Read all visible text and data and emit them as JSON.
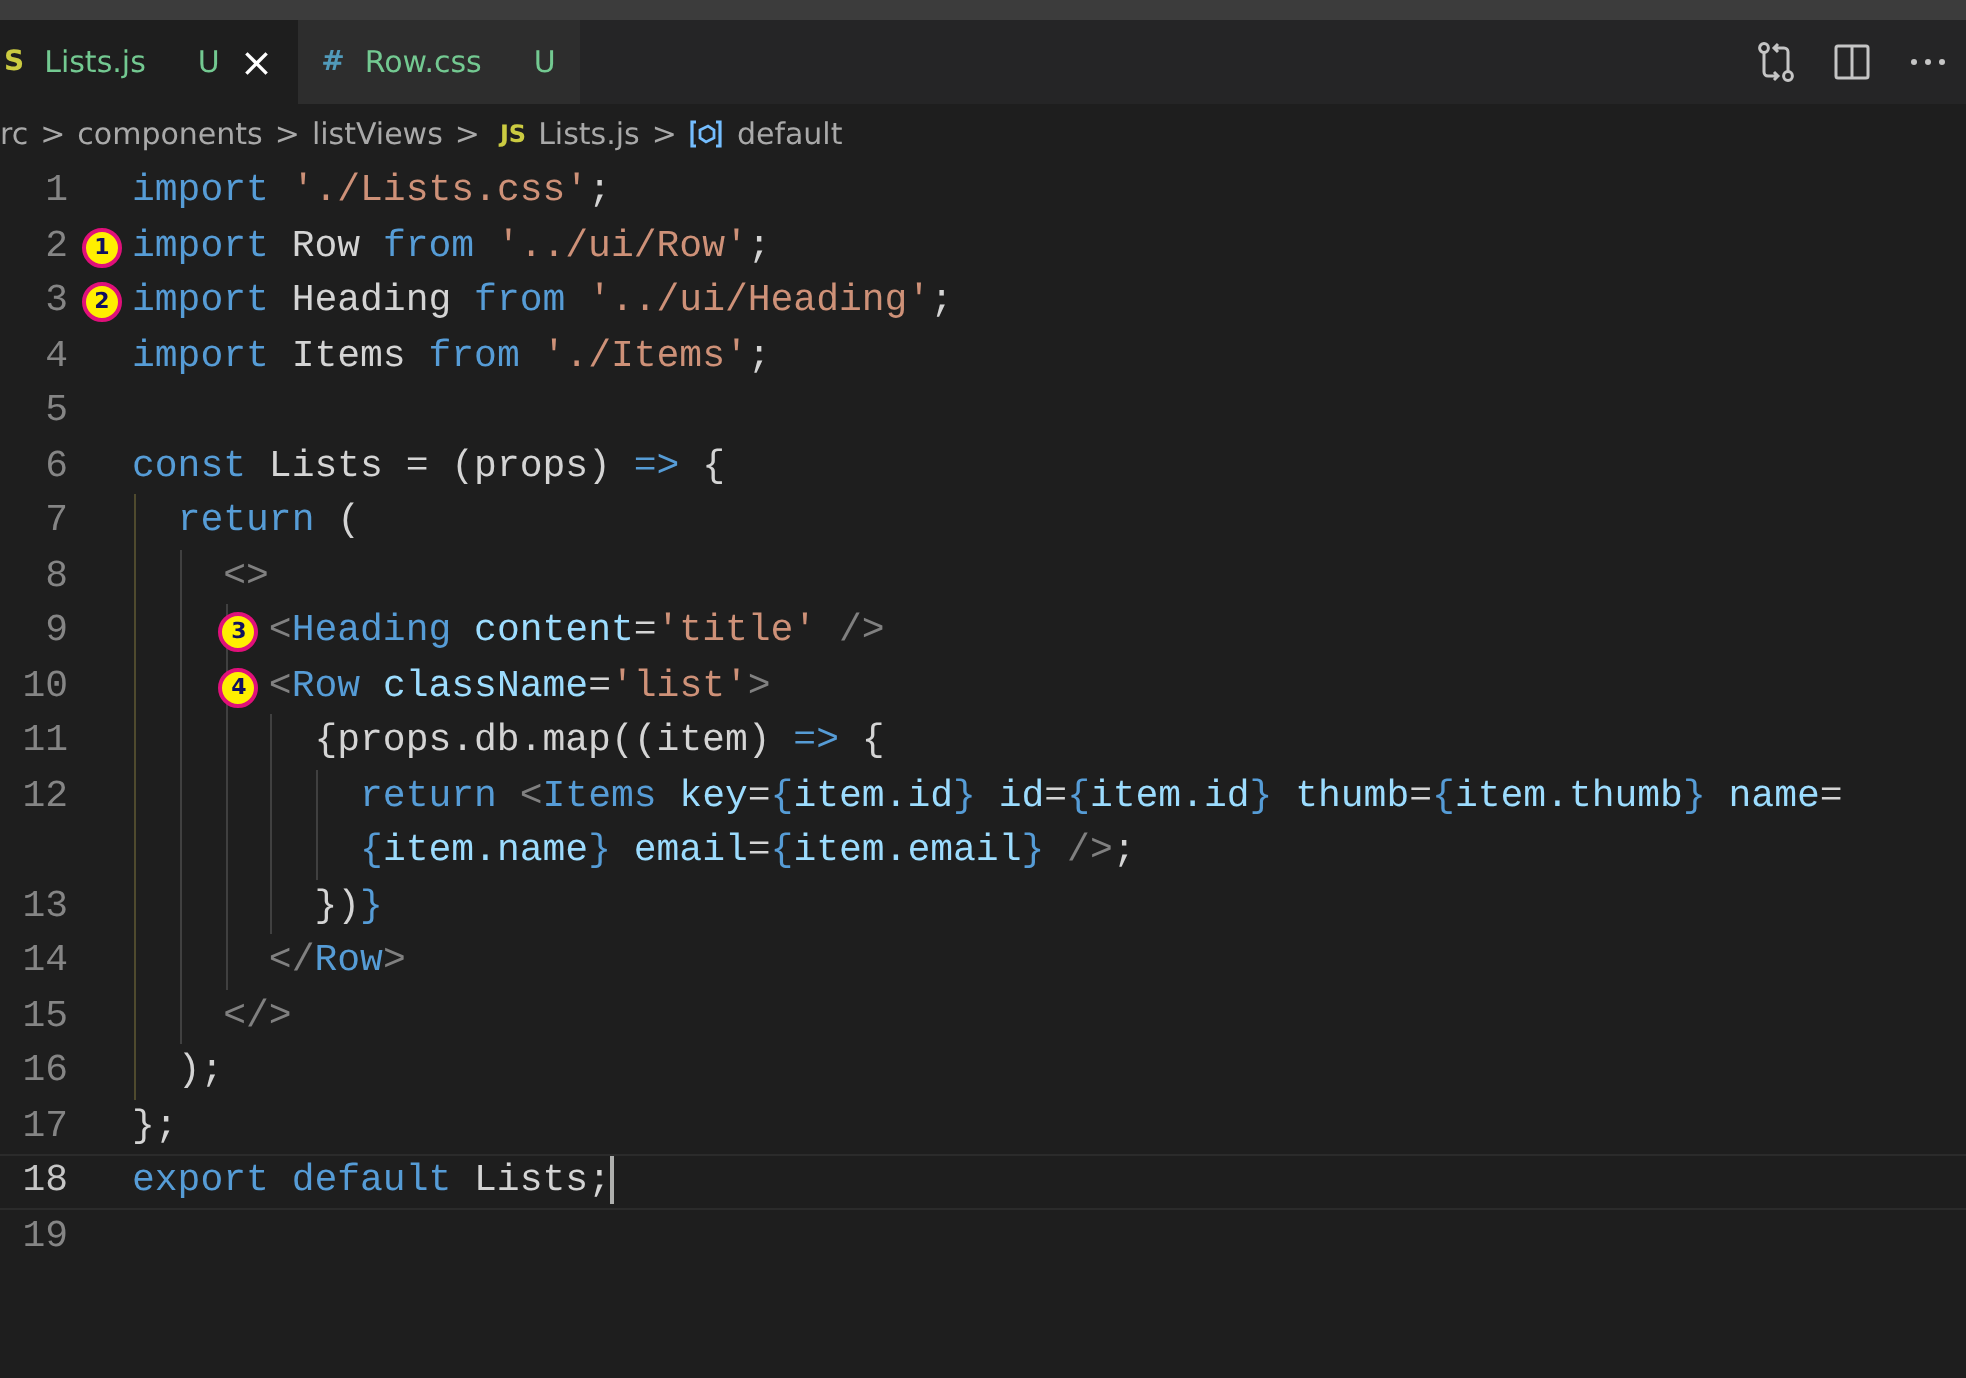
{
  "tabs": [
    {
      "icon": "S",
      "label": "Lists.js",
      "status": "U",
      "close": "×",
      "selected": true,
      "kind": "js"
    },
    {
      "icon": "#",
      "label": "Row.css",
      "status": "U",
      "selected": false,
      "kind": "css"
    }
  ],
  "breadcrumbs": [
    {
      "kind": "folder",
      "label": "rc"
    },
    {
      "kind": "folder",
      "label": "components"
    },
    {
      "kind": "folder",
      "label": "listViews"
    },
    {
      "kind": "file",
      "icon": "JS",
      "label": "Lists.js"
    },
    {
      "kind": "symbol",
      "label": "default"
    }
  ],
  "breadcrumb_separator": ">",
  "lines": [
    {
      "number": "1",
      "current": false,
      "tokens": [
        {
          "kind": "kw",
          "text": "import "
        },
        {
          "kind": "str",
          "text": "'./Lists.css'"
        },
        {
          "kind": "plain",
          "text": ";"
        }
      ]
    },
    {
      "number": "2",
      "current": false,
      "marker": "1",
      "tokens": [
        {
          "kind": "kw",
          "text": "import "
        },
        {
          "kind": "plain",
          "text": "Row "
        },
        {
          "kind": "kw",
          "text": "from "
        },
        {
          "kind": "str",
          "text": "'../ui/Row'"
        },
        {
          "kind": "plain",
          "text": ";"
        }
      ]
    },
    {
      "number": "3",
      "current": false,
      "marker": "2",
      "tokens": [
        {
          "kind": "kw",
          "text": "import "
        },
        {
          "kind": "plain",
          "text": "Heading "
        },
        {
          "kind": "kw",
          "text": "from "
        },
        {
          "kind": "str",
          "text": "'../ui/Heading'"
        },
        {
          "kind": "plain",
          "text": ";"
        }
      ]
    },
    {
      "number": "4",
      "current": false,
      "tokens": [
        {
          "kind": "kw",
          "text": "import "
        },
        {
          "kind": "plain",
          "text": "Items "
        },
        {
          "kind": "kw",
          "text": "from "
        },
        {
          "kind": "str",
          "text": "'./Items'"
        },
        {
          "kind": "plain",
          "text": ";"
        }
      ]
    },
    {
      "number": "5",
      "current": false
    },
    {
      "number": "6",
      "current": false,
      "tokens": [
        {
          "kind": "kw",
          "text": "const "
        },
        {
          "kind": "plain",
          "text": "Lists = (props) "
        },
        {
          "kind": "kw",
          "text": "=>"
        },
        {
          "kind": "plain",
          "text": " {"
        }
      ]
    },
    {
      "number": "7",
      "current": false,
      "tokens": [
        {
          "kind": "kw",
          "text": "  return"
        },
        {
          "kind": "plain",
          "text": " ("
        }
      ]
    },
    {
      "number": "8",
      "current": false,
      "tokens": [
        {
          "kind": "punc",
          "text": "    <>"
        }
      ]
    },
    {
      "number": "9",
      "current": false,
      "marker": "3",
      "tokens": [
        {
          "kind": "punc",
          "text": "      <"
        },
        {
          "kind": "kw",
          "text": "Heading"
        },
        {
          "kind": "var",
          "text": " content"
        },
        {
          "kind": "plain",
          "text": "="
        },
        {
          "kind": "str",
          "text": "'title'"
        },
        {
          "kind": "punc",
          "text": " />"
        }
      ]
    },
    {
      "number": "10",
      "current": false,
      "marker": "4",
      "tokens": [
        {
          "kind": "punc",
          "text": "      <"
        },
        {
          "kind": "kw",
          "text": "Row"
        },
        {
          "kind": "var",
          "text": " className"
        },
        {
          "kind": "plain",
          "text": "="
        },
        {
          "kind": "str",
          "text": "'list'"
        },
        {
          "kind": "punc",
          "text": ">"
        }
      ]
    },
    {
      "number": "11",
      "current": false,
      "tokens": [
        {
          "kind": "plain",
          "text": "        {props.db.map((item) "
        },
        {
          "kind": "kw",
          "text": "=>"
        },
        {
          "kind": "plain",
          "text": " {"
        }
      ]
    },
    {
      "number": "12",
      "current": false,
      "tokens": [
        {
          "kind": "kw",
          "text": "          return "
        },
        {
          "kind": "punc",
          "text": "<"
        },
        {
          "kind": "kw",
          "text": "Items"
        },
        {
          "kind": "var",
          "text": " key"
        },
        {
          "kind": "plain",
          "text": "="
        },
        {
          "kind": "kw",
          "text": "{"
        },
        {
          "kind": "var",
          "text": "item.id"
        },
        {
          "kind": "kw",
          "text": "}"
        },
        {
          "kind": "var",
          "text": " id"
        },
        {
          "kind": "plain",
          "text": "="
        },
        {
          "kind": "kw",
          "text": "{"
        },
        {
          "kind": "var",
          "text": "item.id"
        },
        {
          "kind": "kw",
          "text": "}"
        },
        {
          "kind": "var",
          "text": " thumb"
        },
        {
          "kind": "plain",
          "text": "="
        },
        {
          "kind": "kw",
          "text": "{"
        },
        {
          "kind": "var",
          "text": "item.thumb"
        },
        {
          "kind": "kw",
          "text": "}"
        },
        {
          "kind": "var",
          "text": " name"
        },
        {
          "kind": "plain",
          "text": "="
        }
      ],
      "continuation": [
        {
          "kind": "kw",
          "text": "          {"
        },
        {
          "kind": "var",
          "text": "item.name"
        },
        {
          "kind": "kw",
          "text": "}"
        },
        {
          "kind": "var",
          "text": " email"
        },
        {
          "kind": "plain",
          "text": "="
        },
        {
          "kind": "kw",
          "text": "{"
        },
        {
          "kind": "var",
          "text": "item.email"
        },
        {
          "kind": "kw",
          "text": "}"
        },
        {
          "kind": "punc",
          "text": " />"
        },
        {
          "kind": "plain",
          "text": ";"
        }
      ]
    },
    {
      "number": "13",
      "current": false,
      "tokens": [
        {
          "kind": "plain",
          "text": "        })"
        },
        {
          "kind": "kw",
          "text": "}"
        }
      ]
    },
    {
      "number": "14",
      "current": false,
      "tokens": [
        {
          "kind": "punc",
          "text": "      </"
        },
        {
          "kind": "kw",
          "text": "Row"
        },
        {
          "kind": "punc",
          "text": ">"
        }
      ]
    },
    {
      "number": "15",
      "current": false,
      "tokens": [
        {
          "kind": "punc",
          "text": "    </>"
        }
      ]
    },
    {
      "number": "16",
      "current": false,
      "tokens": [
        {
          "kind": "plain",
          "text": "  );"
        }
      ]
    },
    {
      "number": "17",
      "current": false,
      "tokens": [
        {
          "kind": "plain",
          "text": "};"
        }
      ]
    },
    {
      "number": "18",
      "current": true,
      "tokens": [
        {
          "kind": "kw",
          "text": "export default "
        },
        {
          "kind": "plain",
          "text": "Lists;"
        }
      ]
    },
    {
      "number": "19",
      "current": false
    }
  ]
}
